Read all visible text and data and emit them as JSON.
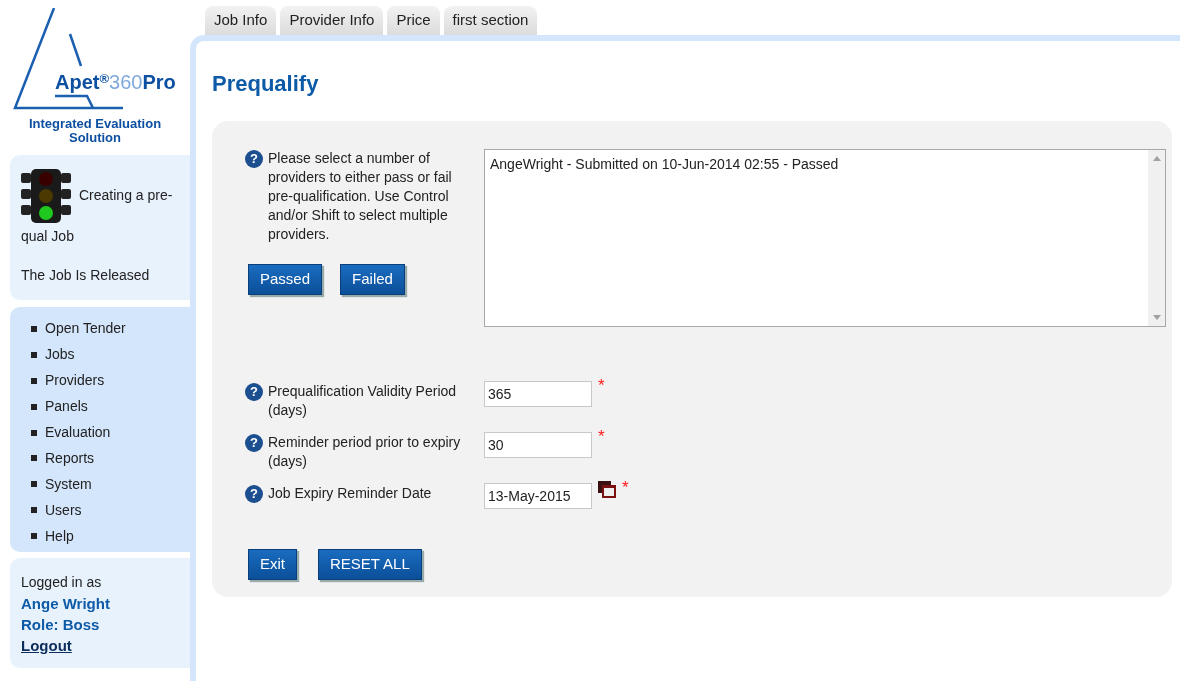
{
  "logo": {
    "prefix": "Apet",
    "mark": "®",
    "middle": "360",
    "suffix": "Pro",
    "tagline": "Integrated Evaluation Solution"
  },
  "status": {
    "green_light": true,
    "text": "Creating a pre-qual Job",
    "release": "The Job Is Released"
  },
  "nav": [
    "Open Tender",
    "Jobs",
    "Providers",
    "Panels",
    "Evaluation",
    "Reports",
    "System",
    "Users",
    "Help"
  ],
  "login": {
    "caption": "Logged in as",
    "user": "Ange Wright",
    "role": "Role: Boss",
    "logout": "Logout"
  },
  "tabs": [
    {
      "label": "Job Info",
      "selected": false
    },
    {
      "label": "Provider Info",
      "selected": false
    },
    {
      "label": "Price",
      "selected": false
    },
    {
      "label": "first section",
      "selected": false
    }
  ],
  "title": "Prequalify",
  "selection": {
    "icon": "?",
    "help": "Please select a number of providers to either pass or fail pre-qualification. Use Control and/or Shift to select multiple providers.",
    "buttons": [
      "Passed",
      "Failed"
    ],
    "options": [
      {
        "text": "AngeWright - Submitted on 10-Jun-2014 02:55 - Passed",
        "selected": false
      }
    ]
  },
  "fields": [
    {
      "icon": "?",
      "label": "Prequalification Validity Period (days)",
      "value": "365",
      "marker": "*",
      "calendar": false
    },
    {
      "icon": "?",
      "label": "Reminder period prior to expiry (days)",
      "value": "30",
      "marker": "*",
      "calendar": false
    },
    {
      "icon": "?",
      "label": "Job Expiry Reminder Date",
      "value": "13-May-2015",
      "marker": "*",
      "calendar": true
    }
  ],
  "actions": [
    "Exit",
    "RESET ALL"
  ]
}
